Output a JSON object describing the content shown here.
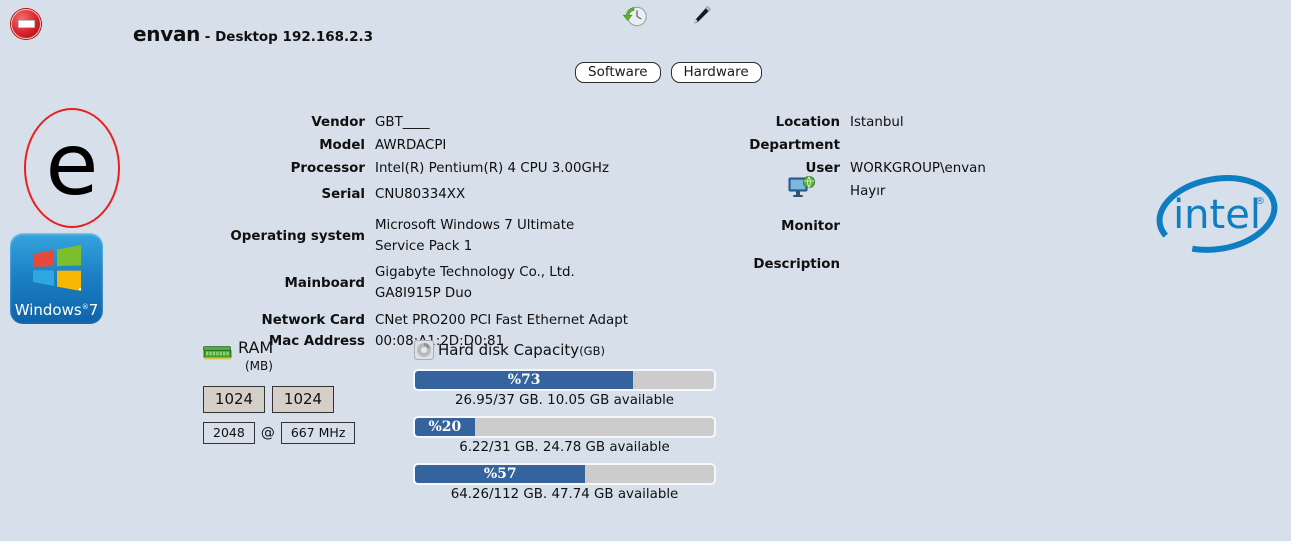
{
  "header": {
    "block_icon": "no-entry-icon",
    "title_main": "envan",
    "title_sub": " - Desktop 192.168.2.3",
    "history_icon": "history-clock-icon",
    "edit_icon": "pen-icon"
  },
  "tabs": {
    "software_label": "Software",
    "hardware_label": "Hardware"
  },
  "logos": {
    "e_letter": "e",
    "windows_label": "Windows",
    "windows_version": "7",
    "windows_reg": "®",
    "intel_label": "intel",
    "intel_reg": "®"
  },
  "info_left": [
    {
      "key": "Vendor",
      "value": "GBT____"
    },
    {
      "key": "Model",
      "value": "AWRDACPI"
    },
    {
      "key": "Processor",
      "value": "Intel(R) Pentium(R) 4 CPU 3.00GHz"
    },
    {
      "key": "Serial",
      "value": "CNU80334XX"
    },
    {
      "key": "Operating system",
      "value": "Microsoft Windows 7 Ultimate\nService Pack 1"
    },
    {
      "key": "Mainboard",
      "value": "Gigabyte Technology Co., Ltd.\nGA8I915P Duo"
    },
    {
      "key": "Network Card\nMac Address",
      "value": "CNet PRO200 PCI Fast Ethernet Adapt\n00:08:A1:2D:D0:81"
    }
  ],
  "info_right": [
    {
      "key": "Location",
      "value": "Istanbul"
    },
    {
      "key": "Department",
      "value": ""
    },
    {
      "key": "User",
      "value": "WORKGROUP\\envan"
    },
    {
      "key": "",
      "value": "Hayır",
      "icon": "network-monitor-icon"
    },
    {
      "key": "Monitor",
      "value": ""
    },
    {
      "key": "Description",
      "value": ""
    }
  ],
  "ram": {
    "icon": "ram-module-icon",
    "title": "RAM",
    "unit": "(MB)",
    "slots": [
      "1024",
      "1024"
    ],
    "total": "2048",
    "at": "@",
    "speed": "667 MHz"
  },
  "harddisk": {
    "icon": "hard-disk-icon",
    "title": "Hard disk Capacity",
    "unit": "(GB)",
    "drives": [
      {
        "percent_label": "%73",
        "percent": 73,
        "caption": "26.95/37 GB. 10.05 GB available"
      },
      {
        "percent_label": "%20",
        "percent": 20,
        "caption": "6.22/31 GB. 24.78 GB available"
      },
      {
        "percent_label": "%57",
        "percent": 57,
        "caption": "64.26/112 GB. 47.74 GB available"
      }
    ]
  },
  "colors": {
    "background": "#d6dfea",
    "bar_fill": "#34639e",
    "bar_track": "#cccccc",
    "accent_red": "#e8201e",
    "intel_blue": "#0f7dc2"
  }
}
